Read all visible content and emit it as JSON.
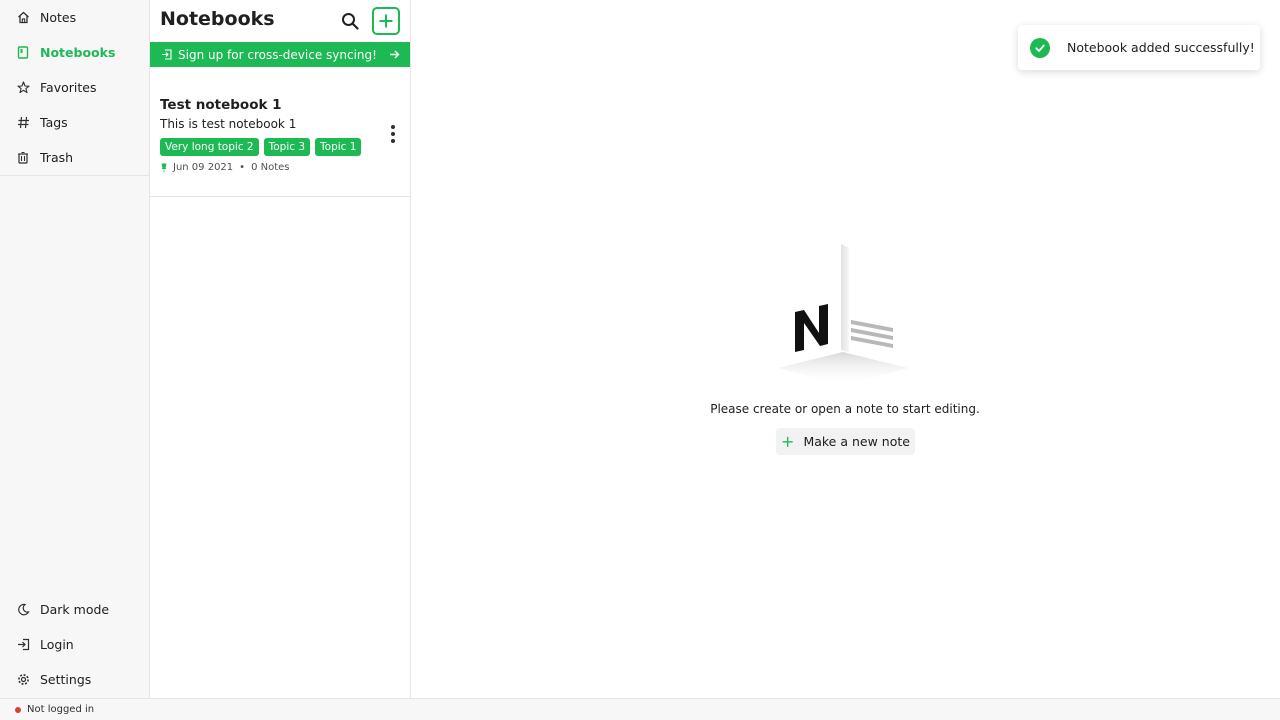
{
  "sidebar": {
    "items": [
      {
        "label": "Notes",
        "icon": "home-icon"
      },
      {
        "label": "Notebooks",
        "icon": "notebook-icon",
        "active": true
      },
      {
        "label": "Favorites",
        "icon": "star-icon"
      },
      {
        "label": "Tags",
        "icon": "hash-icon"
      },
      {
        "label": "Trash",
        "icon": "trash-icon"
      }
    ],
    "bottom_items": [
      {
        "label": "Dark mode",
        "icon": "moon-icon"
      },
      {
        "label": "Login",
        "icon": "login-icon"
      },
      {
        "label": "Settings",
        "icon": "gear-icon"
      }
    ]
  },
  "list": {
    "title": "Notebooks",
    "signup_text": "Sign up for cross-device syncing!",
    "notebooks": [
      {
        "title": "Test notebook 1",
        "description": "This is test notebook 1",
        "tags": [
          "Very long topic 2",
          "Topic 3",
          "Topic 1"
        ],
        "date": "Jun 09 2021",
        "separator": "•",
        "note_count": "0 Notes"
      }
    ]
  },
  "editor": {
    "placeholder": "Please create or open a note to start editing.",
    "new_note_label": "Make a new note"
  },
  "toast": {
    "message": "Notebook added successfully!"
  },
  "status": {
    "text": "Not logged in"
  },
  "colors": {
    "accent": "#1db954",
    "status_error": "#e53935"
  }
}
